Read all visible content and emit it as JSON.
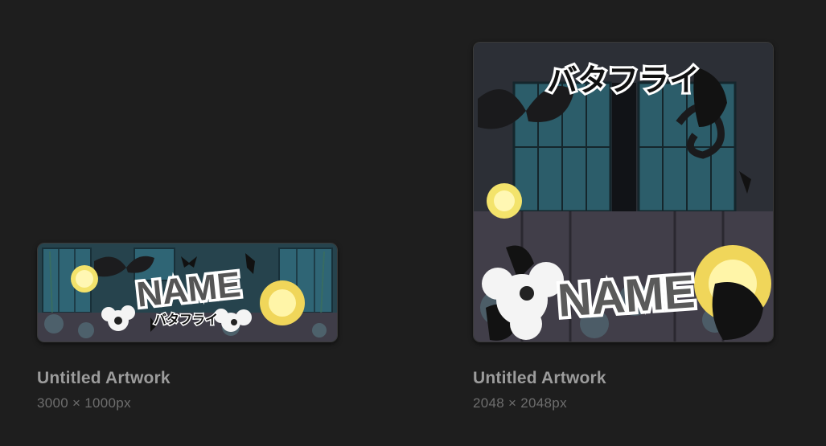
{
  "gallery": {
    "artworks": [
      {
        "title": "Untitled Artwork",
        "dimensions": "3000 × 1000px",
        "thumbnail": {
          "name_text": "NAME",
          "sub_text": "バタフライ"
        }
      },
      {
        "title": "Untitled Artwork",
        "dimensions": "2048 × 2048px",
        "thumbnail": {
          "name_text": "NAME",
          "sub_text": "バタフライ"
        }
      }
    ]
  },
  "colors": {
    "background": "#1e1e1e",
    "title_text": "#9c9c9c",
    "dims_text": "#6e6e6e",
    "scene_teal": "#2c5d6a",
    "lantern_yellow": "#f3e36b"
  }
}
